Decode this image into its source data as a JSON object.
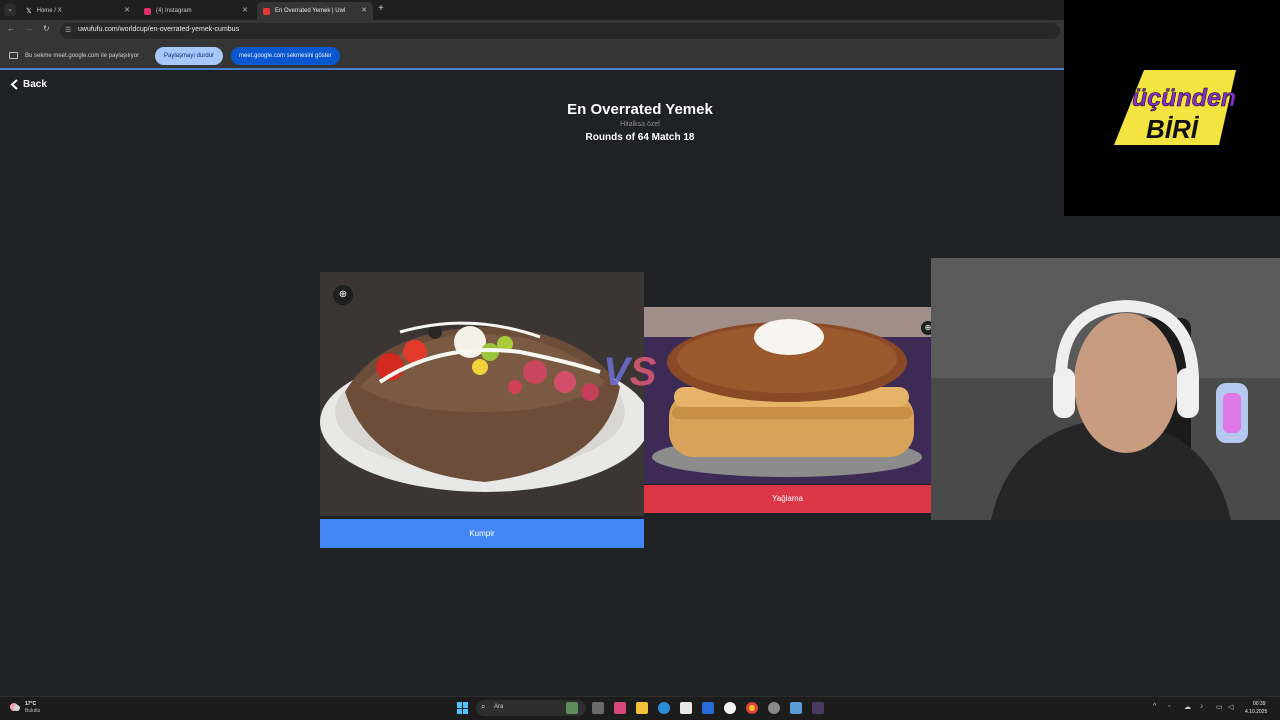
{
  "browser": {
    "tabs": [
      {
        "label": "Home / X",
        "favicon_color": "#ffffff"
      },
      {
        "label": "(4) Instagram",
        "favicon_color": "#e1306c"
      },
      {
        "label": "En Overrated Yemek | Uwl",
        "favicon_color": "#e53935",
        "active": true
      }
    ],
    "url": "uwufufu.com/worldcup/en-overrated-yemek-cumbus",
    "share_bar": {
      "text": "Bu sekme meet.google.com ile paylaşılıyor",
      "stop_label": "Paylaşmayı durdur",
      "show_label": "meet.google.com sekmesini göster"
    }
  },
  "page": {
    "back_label": "Back",
    "title": "En Overrated Yemek",
    "subtitle": "Hitalksa özel",
    "round": "Rounds of 64 Match 18",
    "vs_label": "VS",
    "left_choice": {
      "label": "Kumpir",
      "color": "#4285f4"
    },
    "right_choice": {
      "label": "Yağlama",
      "color": "#dc3545"
    }
  },
  "overlay": {
    "logo_line1": "üçünden",
    "logo_line2": "BİRİ"
  },
  "taskbar": {
    "weather_temp": "17°C",
    "weather_desc": "Bulutlu",
    "search_label": "Ara",
    "time": "00:39",
    "date": "4.10.2025"
  }
}
